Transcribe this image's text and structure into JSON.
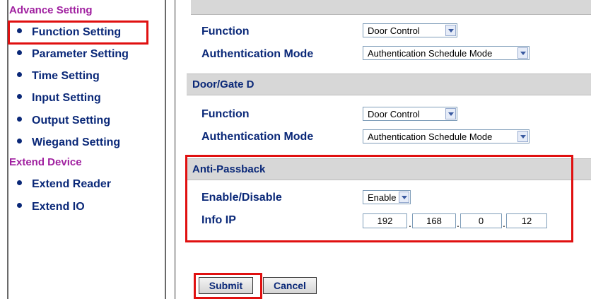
{
  "sidebar": {
    "advance_heading": "Advance Setting",
    "advance_items": [
      {
        "label": "Function Setting"
      },
      {
        "label": "Parameter Setting"
      },
      {
        "label": "Time Setting"
      },
      {
        "label": "Input Setting"
      },
      {
        "label": "Output Setting"
      },
      {
        "label": "Wiegand Setting"
      }
    ],
    "extend_heading": "Extend Device",
    "extend_items": [
      {
        "label": "Extend Reader"
      },
      {
        "label": "Extend IO"
      }
    ]
  },
  "door_c": {
    "function_label": "Function",
    "function_value": "Door Control",
    "auth_label": "Authentication Mode",
    "auth_value": "Authentication Schedule Mode"
  },
  "door_d": {
    "title": "Door/Gate D",
    "function_label": "Function",
    "function_value": "Door Control",
    "auth_label": "Authentication Mode",
    "auth_value": "Authentication Schedule Mode"
  },
  "anti_passback": {
    "title": "Anti-Passback",
    "enable_label": "Enable/Disable",
    "enable_value": "Enable",
    "ip_label": "Info IP",
    "ip_octets": [
      "192",
      "168",
      "0",
      "12"
    ]
  },
  "actions": {
    "submit_label": "Submit",
    "cancel_label": "Cancel"
  },
  "colors": {
    "label_blue": "#0a2878",
    "heading_purple": "#a020a0",
    "highlight_red": "#e01010",
    "group_bar_gray": "#d7d7d7"
  }
}
